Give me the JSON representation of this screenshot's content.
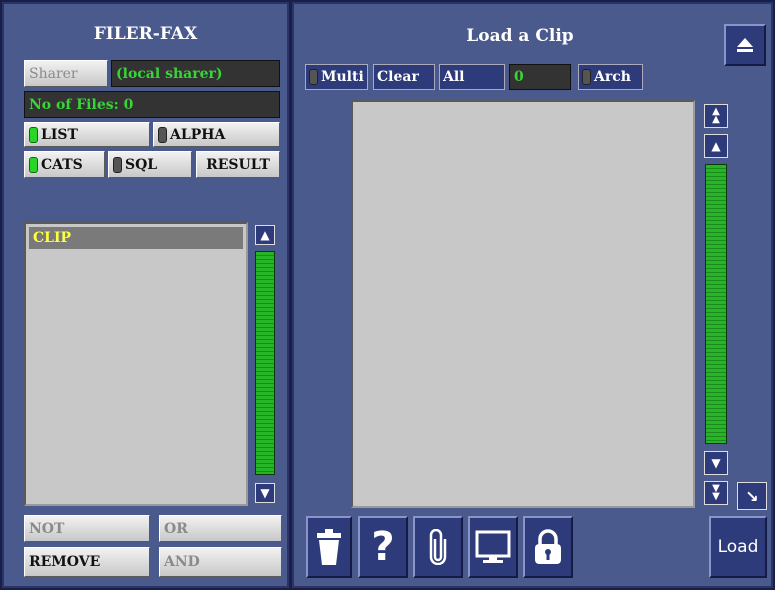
{
  "left_panel": {
    "title": "FILER-FAX",
    "sharer_label": "Sharer",
    "sharer_value": "(local sharer)",
    "files_count": "No of Files: 0",
    "buttons": {
      "list": "LIST",
      "alpha": "ALPHA",
      "cats": "CATS",
      "sql": "SQL",
      "result": "RESULT"
    },
    "list_items": [
      "CLIP"
    ],
    "bottom_buttons": {
      "not": "NOT",
      "or": "OR",
      "remove": "REMOVE",
      "and": "AND"
    }
  },
  "right_panel": {
    "title": "Load a Clip",
    "toolbar": {
      "multi": "Multi",
      "clear": "Clear",
      "all": "All",
      "count": "0",
      "arch": "Arch"
    },
    "load_label": "Load"
  },
  "colors": {
    "panel": "#4a5a8c",
    "led_on": "#27d627",
    "button_dark": "#2e3b7a"
  }
}
